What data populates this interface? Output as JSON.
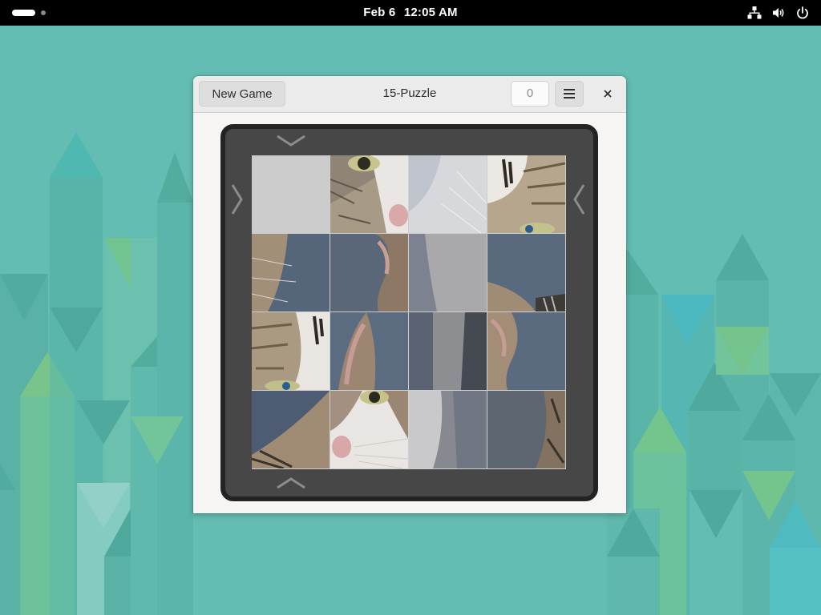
{
  "topbar": {
    "date": "Feb 6",
    "time": "12:05 AM",
    "icons": [
      "network-icon",
      "volume-icon",
      "power-icon"
    ]
  },
  "window": {
    "title": "15-Puzzle",
    "new_game_label": "New Game",
    "moves": "0",
    "menu_icon": "hamburger-menu-icon",
    "close_icon": "close-icon"
  },
  "puzzle": {
    "rows": 4,
    "cols": 4,
    "image": "cat face photo",
    "empty_tile": [
      0,
      0
    ],
    "arrows": [
      "arrow-down-icon",
      "arrow-right-icon",
      "arrow-left-icon",
      "arrow-up-icon"
    ]
  },
  "colors": {
    "desktop": "#63bdb2",
    "board": "#474747",
    "board_border": "#232323"
  }
}
